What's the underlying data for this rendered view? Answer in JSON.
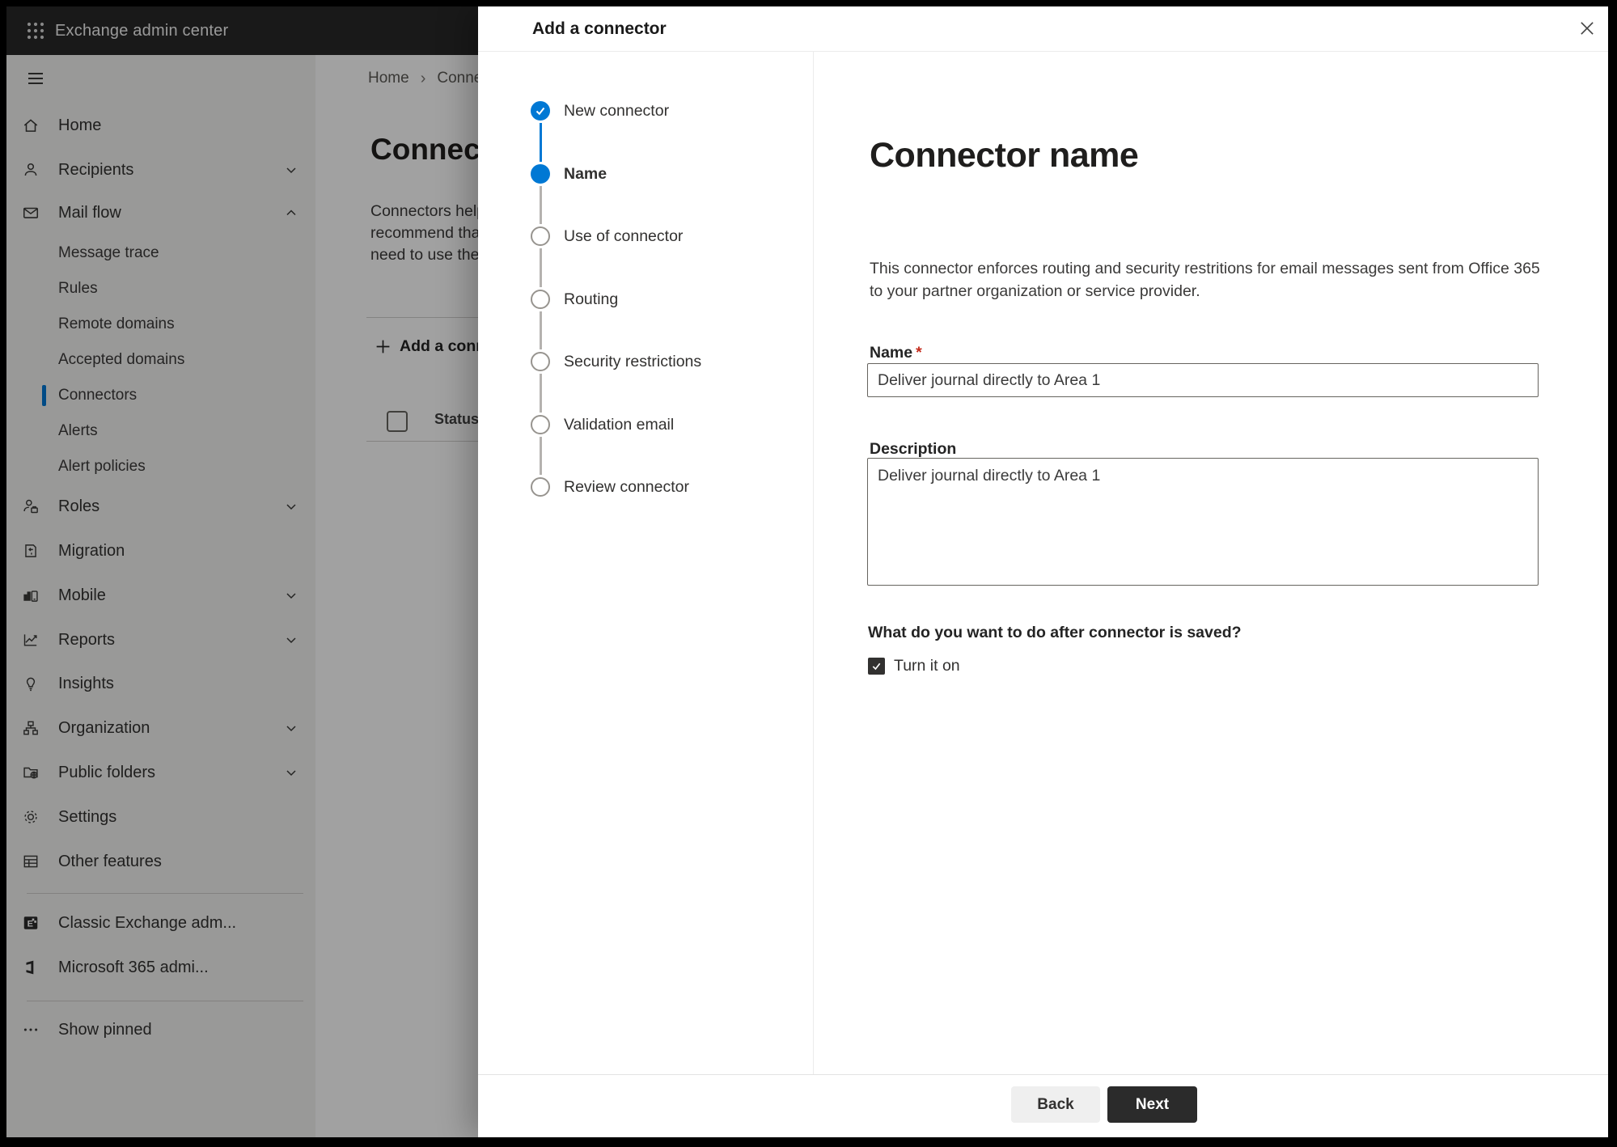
{
  "app": {
    "title": "Exchange admin center"
  },
  "sidebar": {
    "items": [
      {
        "label": "Home"
      },
      {
        "label": "Recipients"
      },
      {
        "label": "Mail flow"
      },
      {
        "label": "Message trace"
      },
      {
        "label": "Rules"
      },
      {
        "label": "Remote domains"
      },
      {
        "label": "Accepted domains"
      },
      {
        "label": "Connectors",
        "selected": true
      },
      {
        "label": "Alerts"
      },
      {
        "label": "Alert policies"
      },
      {
        "label": "Roles"
      },
      {
        "label": "Migration"
      },
      {
        "label": "Mobile"
      },
      {
        "label": "Reports"
      },
      {
        "label": "Insights"
      },
      {
        "label": "Organization"
      },
      {
        "label": "Public folders"
      },
      {
        "label": "Settings"
      },
      {
        "label": "Other features"
      },
      {
        "label": "Classic Exchange adm..."
      },
      {
        "label": "Microsoft 365 admi..."
      },
      {
        "label": "Show pinned"
      }
    ]
  },
  "page": {
    "breadcrumb": {
      "home": "Home",
      "separator": "›",
      "current": "Connectors"
    },
    "title": "Connectors",
    "intro_lines": [
      "Connectors help",
      "recommend that",
      "need to use them"
    ],
    "add_button": "Add a connector",
    "table": {
      "status_header": "Status"
    }
  },
  "dialog": {
    "title": "Add a connector",
    "steps": [
      {
        "label": "New connector",
        "state": "completed"
      },
      {
        "label": "Name",
        "state": "current"
      },
      {
        "label": "Use of connector",
        "state": "upcoming"
      },
      {
        "label": "Routing",
        "state": "upcoming"
      },
      {
        "label": "Security restrictions",
        "state": "upcoming"
      },
      {
        "label": "Validation email",
        "state": "upcoming"
      },
      {
        "label": "Review connector",
        "state": "upcoming"
      }
    ],
    "content": {
      "heading": "Connector name",
      "description": "This connector enforces routing and security restritions for email messages sent from Office 365 to your partner organization or service provider.",
      "name_label": "Name",
      "required_marker": "*",
      "name_value": "Deliver journal directly to Area 1",
      "description_label": "Description",
      "description_value": "Deliver journal directly to Area 1",
      "after_save_question": "What do you want to do after connector is saved?",
      "turn_on_label": "Turn it on"
    },
    "footer": {
      "back_label": "Back",
      "next_label": "Next"
    }
  },
  "colors": {
    "accent": "#0078d4",
    "required": "#c42b1c",
    "primary_button": "#2b2b2b",
    "header_bg": "#282828",
    "sidebar_bg": "#f3f2f1"
  }
}
